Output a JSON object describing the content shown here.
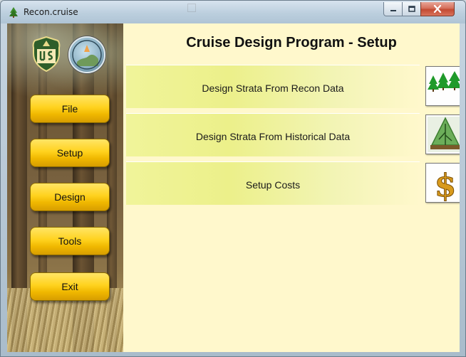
{
  "window": {
    "title": "Recon.cruise",
    "controls": {
      "minimize": "minimize",
      "maximize": "maximize",
      "close": "close"
    }
  },
  "main": {
    "heading": "Cruise Design Program - Setup",
    "options": [
      {
        "label": "Design Strata From Recon Data",
        "icon": "trees-icon"
      },
      {
        "label": "Design Strata From Historical Data",
        "icon": "tree-chart-icon"
      },
      {
        "label": "Setup Costs",
        "icon": "dollar-icon"
      }
    ]
  },
  "sidebar": {
    "nav": [
      {
        "label": "File"
      },
      {
        "label": "Setup"
      },
      {
        "label": "Design"
      },
      {
        "label": "Tools"
      },
      {
        "label": "Exit"
      }
    ],
    "logos": [
      "usfs-shield-icon",
      "seal-icon"
    ]
  },
  "colors": {
    "content_bg": "#fff8cc",
    "nav_button": "#ffd21e",
    "option_band": "#ecf08a"
  }
}
